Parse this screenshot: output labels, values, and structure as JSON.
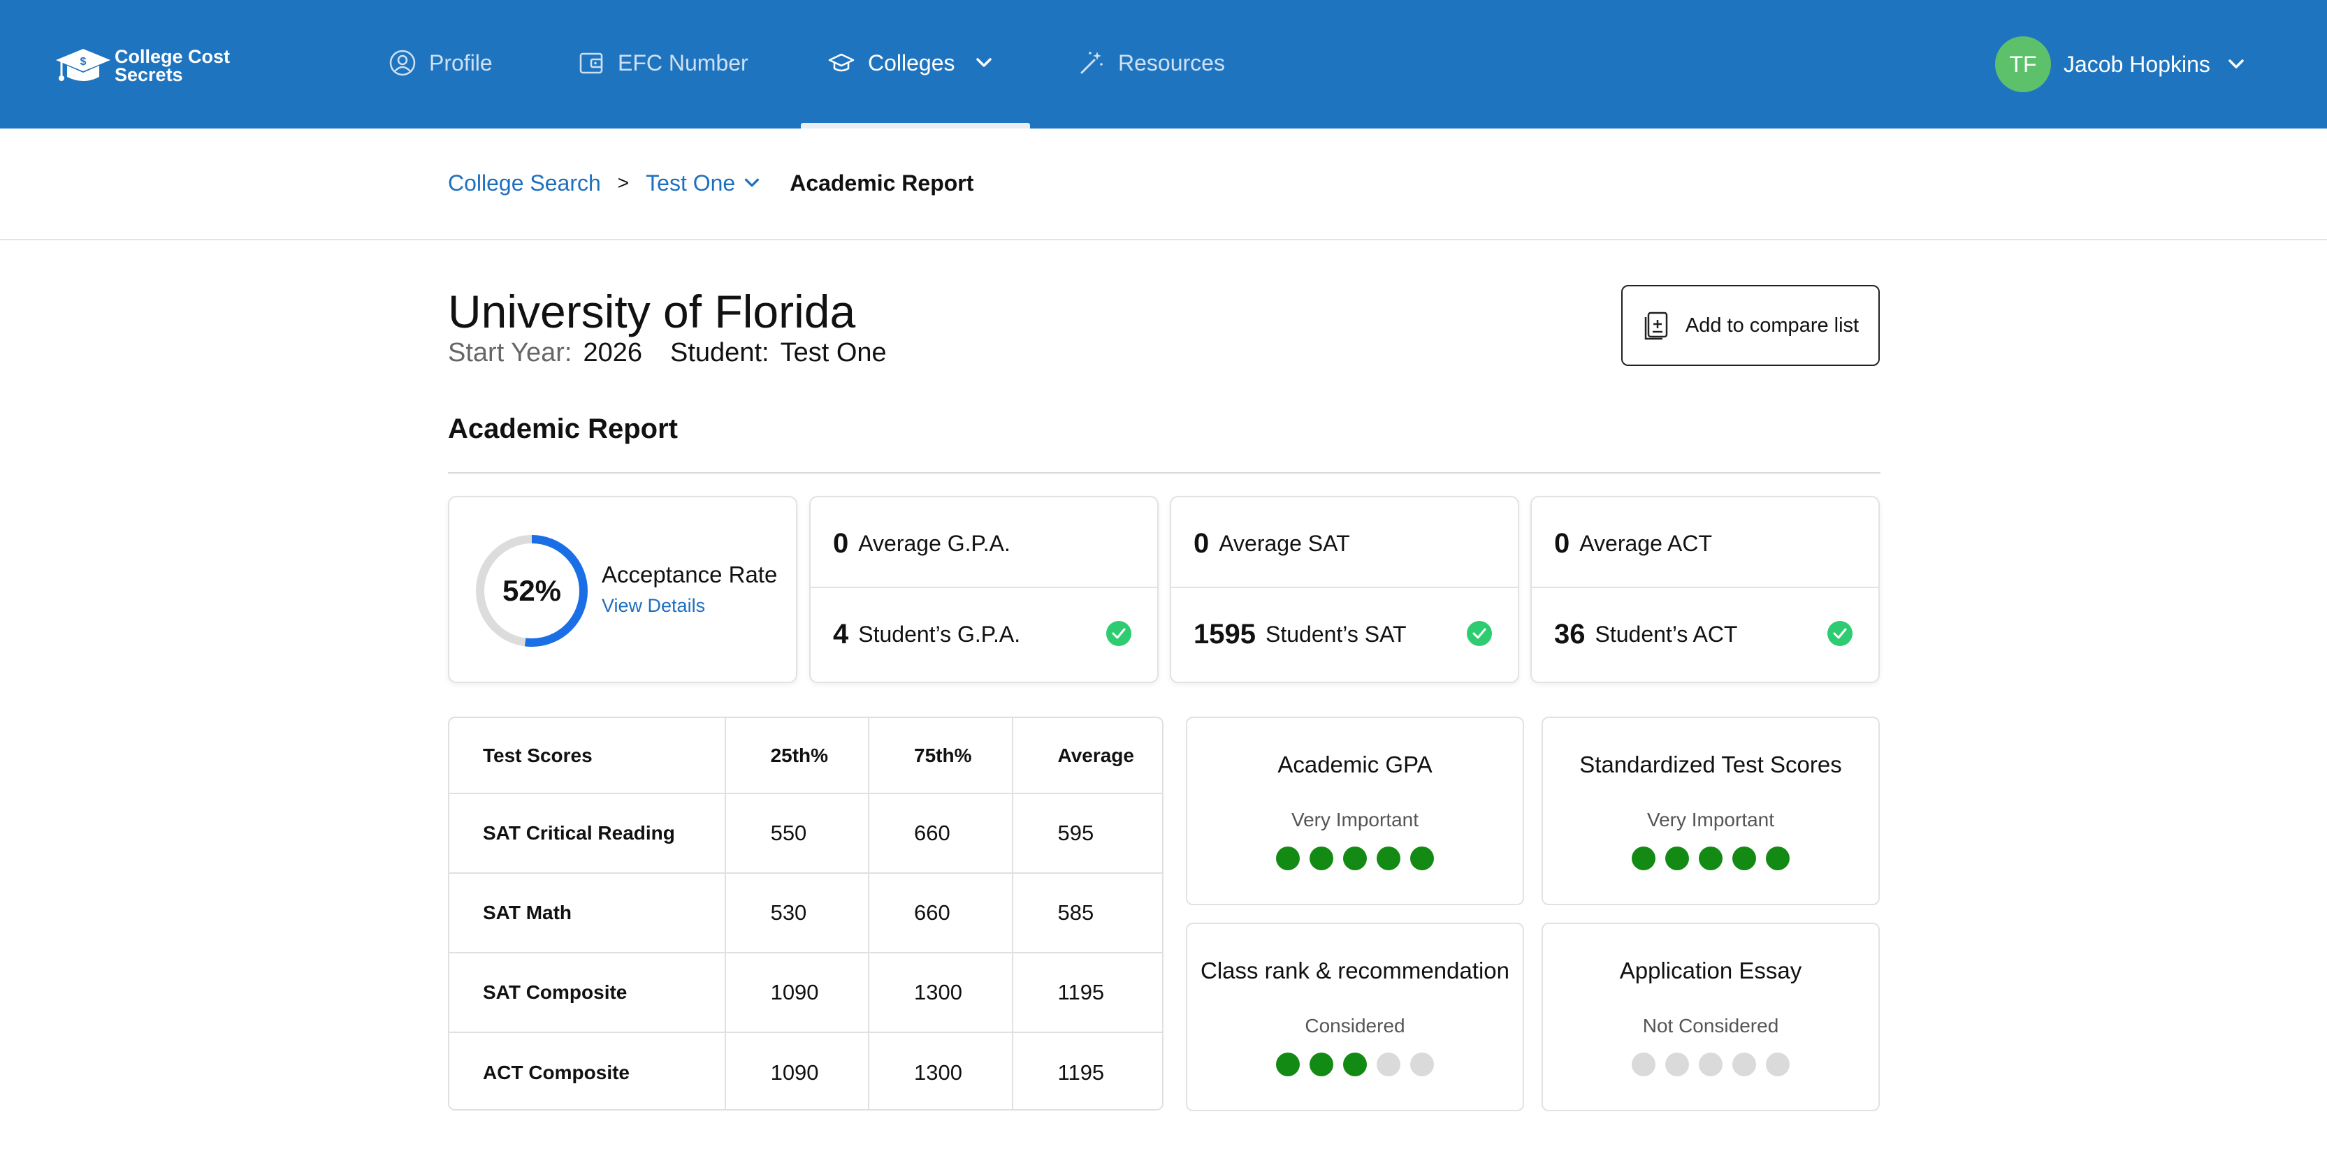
{
  "brand": {
    "line1": "College Cost",
    "line2": "Secrets"
  },
  "nav": [
    {
      "label": "Profile",
      "icon": "user-circle-icon"
    },
    {
      "label": "EFC Number",
      "icon": "wallet-icon"
    },
    {
      "label": "Colleges",
      "icon": "graduation-cap-icon",
      "active": true
    },
    {
      "label": "Resources",
      "icon": "magic-wand-icon"
    }
  ],
  "user": {
    "initials": "TF",
    "name": "Jacob Hopkins"
  },
  "breadcrumb": {
    "root": "College Search",
    "sep": ">",
    "student": "Test One",
    "current": "Academic Report"
  },
  "college": {
    "name": "University of Florida",
    "start_label": "Start Year:",
    "start_year": "2026",
    "student_label": "Student:",
    "student": "Test One"
  },
  "compare_button": "Add to compare list",
  "section_title": "Academic Report",
  "acceptance": {
    "value": "52%",
    "percent": 52,
    "label": "Acceptance Rate",
    "link": "View Details"
  },
  "stats": [
    {
      "avg_value": "0",
      "avg_label": "Average G.P.A.",
      "student_value": "4",
      "student_label": "Student’s G.P.A."
    },
    {
      "avg_value": "0",
      "avg_label": "Average SAT",
      "student_value": "1595",
      "student_label": "Student’s SAT"
    },
    {
      "avg_value": "0",
      "avg_label": "Average ACT",
      "student_value": "36",
      "student_label": "Student’s ACT"
    }
  ],
  "test_table": {
    "headers": [
      "Test Scores",
      "25th%",
      "75th%",
      "Average"
    ],
    "rows": [
      [
        "SAT Critical Reading",
        "550",
        "660",
        "595"
      ],
      [
        "SAT Math",
        "530",
        "660",
        "585"
      ],
      [
        "SAT Composite",
        "1090",
        "1300",
        "1195"
      ],
      [
        "ACT Composite",
        "1090",
        "1300",
        "1195"
      ]
    ]
  },
  "importance": [
    {
      "title": "Academic GPA",
      "level": "Very Important",
      "score": 5
    },
    {
      "title": "Standardized Test Scores",
      "level": "Very Important",
      "score": 5
    },
    {
      "title": "Class rank & recommendation",
      "level": "Considered",
      "score": 3
    },
    {
      "title": "Application Essay",
      "level": "Not Considered",
      "score": 0
    }
  ],
  "colors": {
    "brand_blue": "#1f74bf",
    "link_blue": "#1f6fbf",
    "ring_blue": "#1a6fe6",
    "success_green": "#2ecc71",
    "dot_green": "#138a13",
    "avatar_green": "#5dc16b"
  }
}
